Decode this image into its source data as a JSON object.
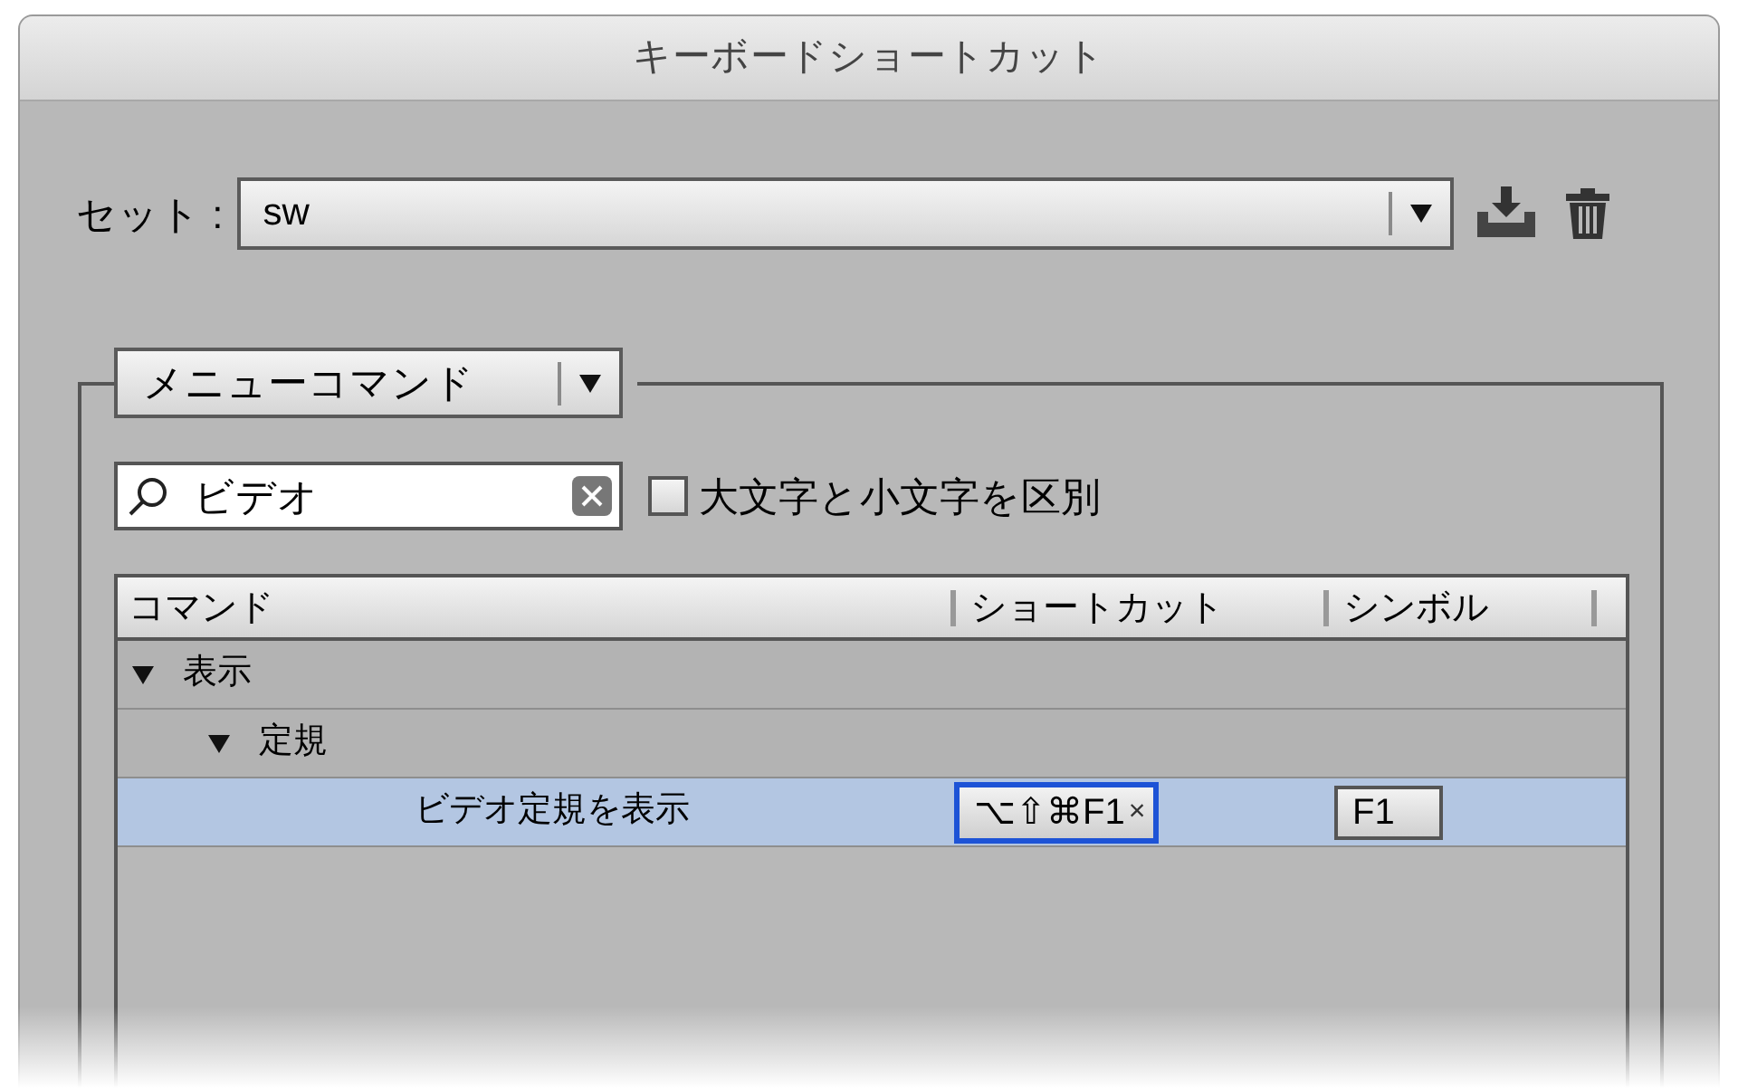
{
  "window": {
    "title": "キーボードショートカット"
  },
  "set": {
    "label": "セット :",
    "value": "sw"
  },
  "scope": {
    "value": "メニューコマンド"
  },
  "search": {
    "value": "ビデオ"
  },
  "case_option": {
    "label": "大文字と小文字を区別",
    "checked": false
  },
  "table": {
    "columns": [
      "コマンド",
      "ショートカット",
      "シンボル"
    ],
    "rows": [
      {
        "label": "表示",
        "expanded": true,
        "selected": false,
        "children": [
          {
            "label": "定規",
            "expanded": true,
            "selected": false,
            "children": [
              {
                "label": "ビデオ定規を表示",
                "selected": true,
                "shortcut": "⌥⇧⌘F1",
                "clear": "×",
                "symbol": "F1"
              }
            ]
          }
        ]
      }
    ]
  }
}
